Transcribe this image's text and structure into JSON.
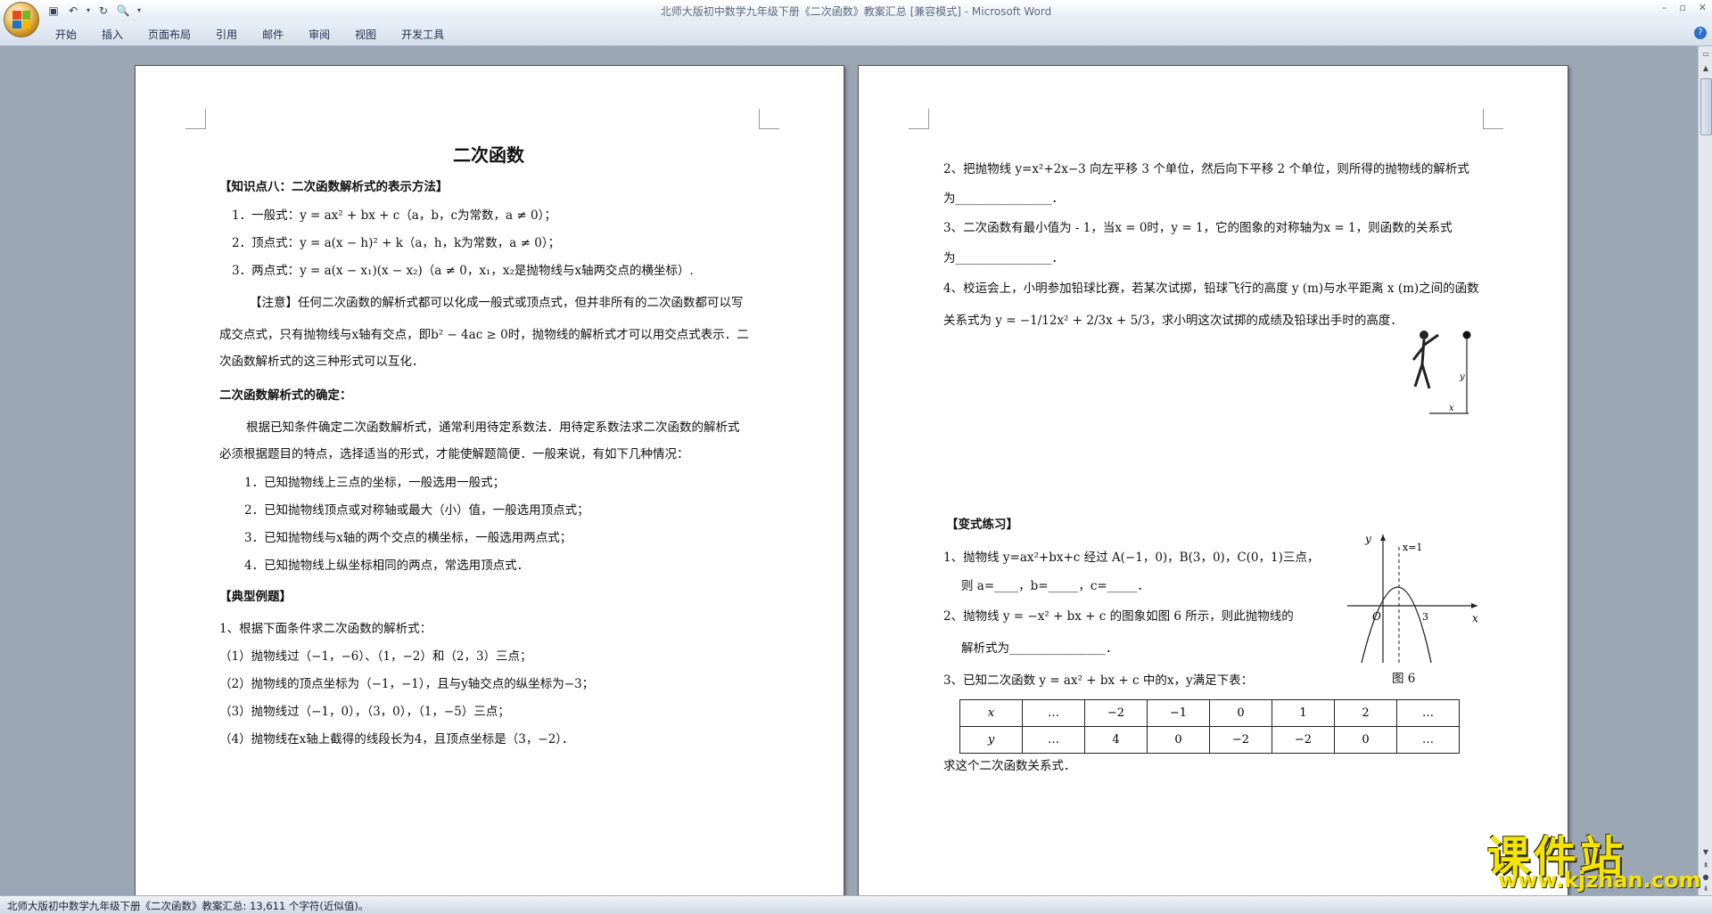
{
  "window": {
    "title": "北师大版初中数学九年级下册《二次函数》教案汇总 [兼容模式] - Microsoft Word"
  },
  "ribbon": {
    "tabs": [
      "开始",
      "插入",
      "页面布局",
      "引用",
      "邮件",
      "审阅",
      "视图",
      "开发工具"
    ]
  },
  "statusbar": {
    "text": "北师大版初中数学九年级下册《二次函数》教案汇总: 13,611 个字符(近似值)。"
  },
  "watermark": {
    "big": "课件站",
    "url": "www.kjzhan.com"
  },
  "left_page": {
    "title": "二次函数",
    "kp_heading": "【知识点八：二次函数解析式的表示方法】",
    "forms": [
      "1．一般式：y = ax² + bx + c（a，b，c为常数，a ≠ 0）；",
      "2．顶点式：y = a(x − h)² + k（a，h，k为常数，a ≠ 0）；",
      "3．两点式：y = a(x − x₁)(x − x₂)（a ≠ 0，x₁，x₂是抛物线与x轴两交点的横坐标）."
    ],
    "note_lines": [
      "【注意】任何二次函数的解析式都可以化成一般式或顶点式，但并非所有的二次函数都可以写",
      "成交点式，只有抛物线与x轴有交点，即b² − 4ac ≥ 0时，抛物线的解析式才可以用交点式表示．二",
      "次函数解析式的这三种形式可以互化．"
    ],
    "determine_heading": "二次函数解析式的确定：",
    "determine_lines": [
      "根据已知条件确定二次函数解析式，通常利用待定系数法．用待定系数法求二次函数的解析式",
      "必须根据题目的特点，选择适当的形式，才能使解题简便．一般来说，有如下几种情况："
    ],
    "cases": [
      "1．已知抛物线上三点的坐标，一般选用一般式；",
      "2．已知抛物线顶点或对称轴或最大（小）值，一般选用顶点式；",
      "3．已知抛物线与x轴的两个交点的横坐标，一般选用两点式；",
      "4．已知抛物线上纵坐标相同的两点，常选用顶点式．"
    ],
    "example_heading": "【典型例题】",
    "example_intro": "1、根据下面条件求二次函数的解析式：",
    "example_items": [
      "（1）抛物线过（−1，−6）、（1，−2）和（2，3）三点；",
      "（2）抛物线的顶点坐标为（−1，−1），且与y轴交点的纵坐标为−3；",
      "（3）抛物线过（−1，0），（3，0），（1，−5）三点；",
      "（4）抛物线在x轴上截得的线段长为4，且顶点坐标是（3，−2）．"
    ]
  },
  "right_page": {
    "q2_line1": "2、把抛物线 y=x²+2x−3 向左平移 3 个单位，然后向下平移 2 个单位，则所得的抛物线的解析式",
    "q2_line2": "为________________．",
    "q3_line1": "3、二次函数有最小值为 - 1，当x = 0时，y = 1，它的图象的对称轴为x = 1，则函数的关系式",
    "q3_line2": "为________________．",
    "q4_line1": "4、校运会上，小明参加铅球比赛，若某次试掷，铅球飞行的高度 y (m)与水平距离 x (m)之间的函数",
    "q4_line2": "关系式为 y = −1/12x² + 2/3x + 5/3，求小明这次试掷的成绩及铅球出手时的高度．",
    "variant_heading": "【变式练习】",
    "v1_line1": "1、抛物线 y=ax²+bx+c 经过 A(−1，0)，B(3，0)，C(0，1)三点，",
    "v1_line2": "则 a=____，b=_____，c=_____．",
    "v2_line1": "2、抛物线 y = −x² + bx + c 的图象如图 6 所示，则此抛物线的",
    "v2_line2": "解析式为________________．",
    "v3_line1": "3、已知二次函数 y = ax² + bx + c 中的x，y满足下表：",
    "table": {
      "row_x": [
        "x",
        "…",
        "−2",
        "−1",
        "0",
        "1",
        "2",
        "…"
      ],
      "row_y": [
        "y",
        "…",
        "4",
        "0",
        "−2",
        "−2",
        "0",
        "…"
      ]
    },
    "v3_tail": "求这个二次函数关系式．",
    "figure6": {
      "caption": "图 6",
      "axis_x": "x",
      "axis_y": "y",
      "origin": "O",
      "tick_3": "3",
      "sym_label": "x=1"
    },
    "athlete": {
      "label_y": "y",
      "label_x": "x"
    }
  }
}
